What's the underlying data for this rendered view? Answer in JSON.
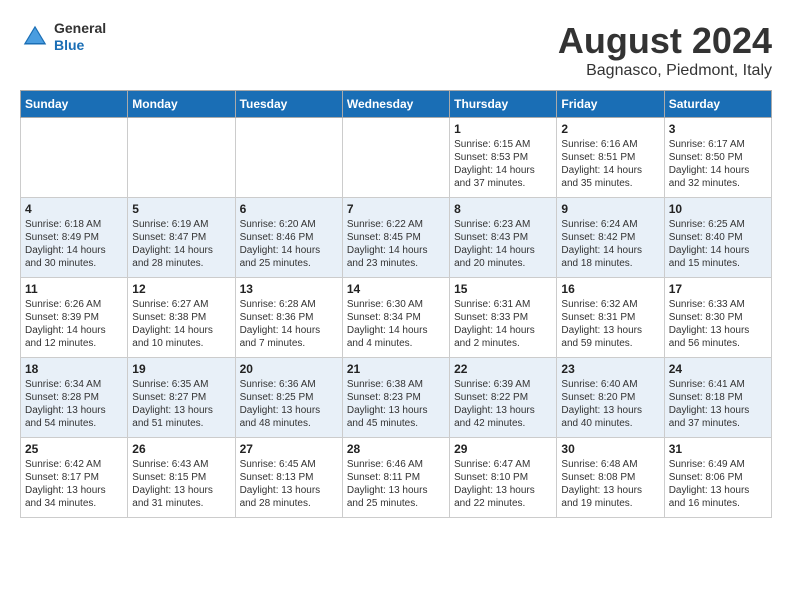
{
  "header": {
    "logo_general": "General",
    "logo_blue": "Blue",
    "month_title": "August 2024",
    "location": "Bagnasco, Piedmont, Italy"
  },
  "weekdays": [
    "Sunday",
    "Monday",
    "Tuesday",
    "Wednesday",
    "Thursday",
    "Friday",
    "Saturday"
  ],
  "weeks": [
    [
      {
        "day": "",
        "info": ""
      },
      {
        "day": "",
        "info": ""
      },
      {
        "day": "",
        "info": ""
      },
      {
        "day": "",
        "info": ""
      },
      {
        "day": "1",
        "info": "Sunrise: 6:15 AM\nSunset: 8:53 PM\nDaylight: 14 hours and 37 minutes."
      },
      {
        "day": "2",
        "info": "Sunrise: 6:16 AM\nSunset: 8:51 PM\nDaylight: 14 hours and 35 minutes."
      },
      {
        "day": "3",
        "info": "Sunrise: 6:17 AM\nSunset: 8:50 PM\nDaylight: 14 hours and 32 minutes."
      }
    ],
    [
      {
        "day": "4",
        "info": "Sunrise: 6:18 AM\nSunset: 8:49 PM\nDaylight: 14 hours and 30 minutes."
      },
      {
        "day": "5",
        "info": "Sunrise: 6:19 AM\nSunset: 8:47 PM\nDaylight: 14 hours and 28 minutes."
      },
      {
        "day": "6",
        "info": "Sunrise: 6:20 AM\nSunset: 8:46 PM\nDaylight: 14 hours and 25 minutes."
      },
      {
        "day": "7",
        "info": "Sunrise: 6:22 AM\nSunset: 8:45 PM\nDaylight: 14 hours and 23 minutes."
      },
      {
        "day": "8",
        "info": "Sunrise: 6:23 AM\nSunset: 8:43 PM\nDaylight: 14 hours and 20 minutes."
      },
      {
        "day": "9",
        "info": "Sunrise: 6:24 AM\nSunset: 8:42 PM\nDaylight: 14 hours and 18 minutes."
      },
      {
        "day": "10",
        "info": "Sunrise: 6:25 AM\nSunset: 8:40 PM\nDaylight: 14 hours and 15 minutes."
      }
    ],
    [
      {
        "day": "11",
        "info": "Sunrise: 6:26 AM\nSunset: 8:39 PM\nDaylight: 14 hours and 12 minutes."
      },
      {
        "day": "12",
        "info": "Sunrise: 6:27 AM\nSunset: 8:38 PM\nDaylight: 14 hours and 10 minutes."
      },
      {
        "day": "13",
        "info": "Sunrise: 6:28 AM\nSunset: 8:36 PM\nDaylight: 14 hours and 7 minutes."
      },
      {
        "day": "14",
        "info": "Sunrise: 6:30 AM\nSunset: 8:34 PM\nDaylight: 14 hours and 4 minutes."
      },
      {
        "day": "15",
        "info": "Sunrise: 6:31 AM\nSunset: 8:33 PM\nDaylight: 14 hours and 2 minutes."
      },
      {
        "day": "16",
        "info": "Sunrise: 6:32 AM\nSunset: 8:31 PM\nDaylight: 13 hours and 59 minutes."
      },
      {
        "day": "17",
        "info": "Sunrise: 6:33 AM\nSunset: 8:30 PM\nDaylight: 13 hours and 56 minutes."
      }
    ],
    [
      {
        "day": "18",
        "info": "Sunrise: 6:34 AM\nSunset: 8:28 PM\nDaylight: 13 hours and 54 minutes."
      },
      {
        "day": "19",
        "info": "Sunrise: 6:35 AM\nSunset: 8:27 PM\nDaylight: 13 hours and 51 minutes."
      },
      {
        "day": "20",
        "info": "Sunrise: 6:36 AM\nSunset: 8:25 PM\nDaylight: 13 hours and 48 minutes."
      },
      {
        "day": "21",
        "info": "Sunrise: 6:38 AM\nSunset: 8:23 PM\nDaylight: 13 hours and 45 minutes."
      },
      {
        "day": "22",
        "info": "Sunrise: 6:39 AM\nSunset: 8:22 PM\nDaylight: 13 hours and 42 minutes."
      },
      {
        "day": "23",
        "info": "Sunrise: 6:40 AM\nSunset: 8:20 PM\nDaylight: 13 hours and 40 minutes."
      },
      {
        "day": "24",
        "info": "Sunrise: 6:41 AM\nSunset: 8:18 PM\nDaylight: 13 hours and 37 minutes."
      }
    ],
    [
      {
        "day": "25",
        "info": "Sunrise: 6:42 AM\nSunset: 8:17 PM\nDaylight: 13 hours and 34 minutes."
      },
      {
        "day": "26",
        "info": "Sunrise: 6:43 AM\nSunset: 8:15 PM\nDaylight: 13 hours and 31 minutes."
      },
      {
        "day": "27",
        "info": "Sunrise: 6:45 AM\nSunset: 8:13 PM\nDaylight: 13 hours and 28 minutes."
      },
      {
        "day": "28",
        "info": "Sunrise: 6:46 AM\nSunset: 8:11 PM\nDaylight: 13 hours and 25 minutes."
      },
      {
        "day": "29",
        "info": "Sunrise: 6:47 AM\nSunset: 8:10 PM\nDaylight: 13 hours and 22 minutes."
      },
      {
        "day": "30",
        "info": "Sunrise: 6:48 AM\nSunset: 8:08 PM\nDaylight: 13 hours and 19 minutes."
      },
      {
        "day": "31",
        "info": "Sunrise: 6:49 AM\nSunset: 8:06 PM\nDaylight: 13 hours and 16 minutes."
      }
    ]
  ]
}
